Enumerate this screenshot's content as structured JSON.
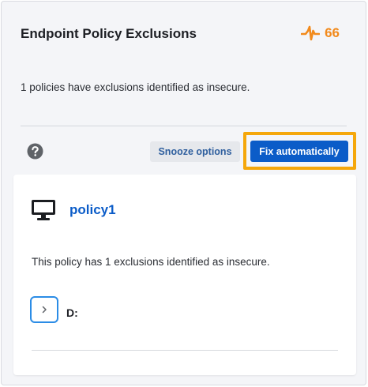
{
  "header": {
    "title": "Endpoint Policy Exclusions",
    "score": "66",
    "score_icon": "pulse-spark-icon",
    "accent_color": "#f28a1c"
  },
  "summary": "1 policies have exclusions identified as insecure.",
  "toolbar": {
    "help_icon": "question-circle-icon",
    "snooze_label": "Snooze options",
    "fix_label": "Fix automatically",
    "primary_color": "#0b5cc8",
    "highlight_color": "#f5a70b"
  },
  "policy": {
    "icon": "monitor-icon",
    "name": "policy1",
    "description": "This policy has 1 exclusions identified as insecure.",
    "expand_icon": "chevron-right-icon",
    "path": "D:"
  }
}
